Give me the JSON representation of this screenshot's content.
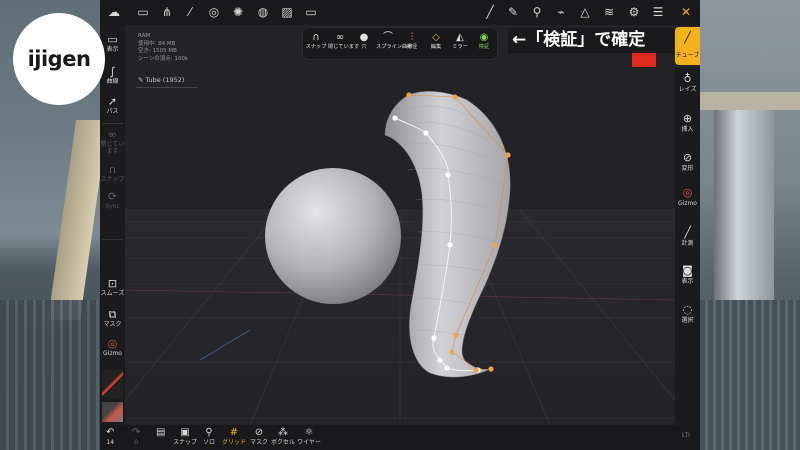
{
  "logo": {
    "text": "ijigen"
  },
  "annotation": {
    "text": "←「検証」で確定"
  },
  "viewport_info": {
    "ram_label": "RAM",
    "used": "使用中: 84 MB",
    "free": "空き: 1505 MB",
    "scene_vertices": "シーンの頂点: 100k",
    "object_name": "Tube (1952)"
  },
  "curve_palette": [
    {
      "icon": "magnet-icon",
      "label": "スナップ"
    },
    {
      "icon": "infinity-icon",
      "label": "閉じています"
    },
    {
      "icon": "hole-icon",
      "label": "穴"
    },
    {
      "icon": "spline-icon",
      "label": "スプライン曲線"
    },
    {
      "icon": "radius-icon",
      "label": "半径"
    },
    {
      "icon": "edit-icon",
      "label": "編集"
    },
    {
      "icon": "mirror-icon",
      "label": "ミラー"
    },
    {
      "icon": "check-icon",
      "label": "検証"
    }
  ],
  "left_sidebar": {
    "items": [
      {
        "icon": "display-icon",
        "label": "表示"
      },
      {
        "icon": "curve-icon",
        "label": "曲線"
      },
      {
        "icon": "path-icon",
        "label": "パス"
      },
      {
        "icon": "infinity-icon",
        "label": "閉じています"
      },
      {
        "icon": "magnet-icon",
        "label": "スナップ"
      },
      {
        "icon": "sync-icon",
        "label": "Sync"
      },
      {
        "icon": "smooth-icon",
        "label": "スムーズ"
      },
      {
        "icon": "mask-icon",
        "label": "マスク"
      },
      {
        "icon": "gizmo-icon",
        "label": "Gizmo"
      }
    ]
  },
  "right_sidebar": {
    "items": [
      {
        "icon": "tube-icon",
        "label": "チューブ"
      },
      {
        "icon": "layers-icon",
        "label": "レイズ"
      },
      {
        "icon": "insert-icon",
        "label": "挿入"
      },
      {
        "icon": "transform-icon",
        "label": "変形"
      },
      {
        "icon": "gizmo-icon",
        "label": "Gizmo"
      },
      {
        "icon": "measure-icon",
        "label": "計測"
      },
      {
        "icon": "camera-icon",
        "label": "表示"
      },
      {
        "icon": "select-icon",
        "label": "選択"
      }
    ]
  },
  "bottom_toolbar": {
    "undo_count": "14",
    "redo_count": "0",
    "items": [
      {
        "icon": "snap-icon",
        "label": "スナップ"
      },
      {
        "icon": "solo-icon",
        "label": "ソロ"
      },
      {
        "icon": "grid-icon",
        "label": "グリッド"
      },
      {
        "icon": "mask-icon",
        "label": "マスク"
      },
      {
        "icon": "voxel-icon",
        "label": "ボクセル"
      },
      {
        "icon": "wireframe-icon",
        "label": "ワイヤー"
      }
    ]
  },
  "corner_label": "LTI",
  "colors": {
    "accent_yellow": "#f2b21b",
    "accent_green": "#7ed957",
    "control_point_orange": "#f0a04b",
    "red_swatch": "#e02b1e"
  }
}
